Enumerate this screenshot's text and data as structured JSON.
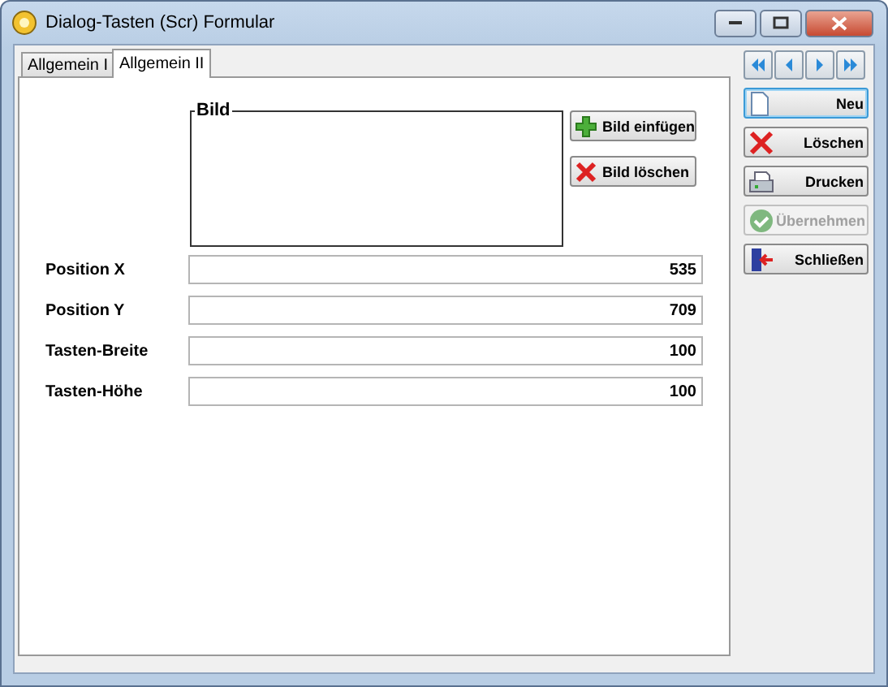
{
  "window": {
    "title": "Dialog-Tasten (Scr) Formular"
  },
  "tabs": [
    {
      "label": "Allgemein I",
      "selected": false
    },
    {
      "label": "Allgemein II",
      "selected": true
    }
  ],
  "picture_group": {
    "title": "Bild",
    "buttons": [
      {
        "label": "Bild einfügen",
        "kind": "add"
      },
      {
        "label": "Bild löschen",
        "kind": "delete"
      }
    ]
  },
  "fields": [
    {
      "label": "Position X",
      "value": "535"
    },
    {
      "label": "Position Y",
      "value": "709"
    },
    {
      "label": "Tasten-Breite",
      "value": "100"
    },
    {
      "label": "Tasten-Höhe",
      "value": "100"
    }
  ],
  "navigation": [
    {
      "kind": "first"
    },
    {
      "kind": "previous"
    },
    {
      "kind": "next"
    },
    {
      "kind": "last"
    }
  ],
  "actions": [
    {
      "label": "Neu",
      "kind": "new",
      "disabled": false
    },
    {
      "label": "Löschen",
      "kind": "delete",
      "disabled": false
    },
    {
      "label": "Drucken",
      "kind": "print",
      "disabled": false
    },
    {
      "label": "Übernehmen",
      "kind": "apply",
      "disabled": true
    },
    {
      "label": "Schließen",
      "kind": "close",
      "disabled": false
    }
  ]
}
